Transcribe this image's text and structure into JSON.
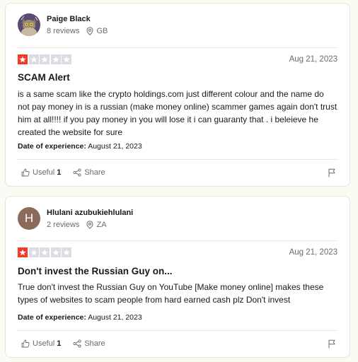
{
  "reviews": [
    {
      "reviewer_name": "Paige Black",
      "reviews_count": "8 reviews",
      "country": "GB",
      "avatar_initial": "",
      "rating": 1,
      "date": "Aug 21, 2023",
      "title": "SCAM Alert",
      "body": "is a same scam like the crypto holdings.com just different colour and the name do not pay money in is a russian (make money online) scammer games again don't trust him at all!!!! if you pay money in you will lose it i can guaranty that . i beleieve he created the website for sure",
      "experience_label": "Date of experience:",
      "experience_date": "August 21, 2023",
      "useful_label": "Useful",
      "useful_count": "1",
      "share_label": "Share"
    },
    {
      "reviewer_name": "Hlulani azubukiehlulani",
      "reviews_count": "2 reviews",
      "country": "ZA",
      "avatar_initial": "H",
      "rating": 1,
      "date": "Aug 21, 2023",
      "title": "Don't invest the Russian Guy on...",
      "body": "True don't invest the Russian Guy on YouTube [Make money online] makes these types of websites to scam people from hard earned cash plz Don't invest",
      "experience_label": "Date of experience:",
      "experience_date": "August 21, 2023",
      "useful_label": "Useful",
      "useful_count": "1",
      "share_label": "Share"
    }
  ],
  "colors": {
    "star_active": "#ff3722",
    "star_inactive": "#dcdce6",
    "background": "#fcfbf3",
    "avatar_initial_bg": "#8c6a5a"
  },
  "icons": [
    "location-pin-icon",
    "thumbs-up-icon",
    "share-icon",
    "flag-icon",
    "star-icon",
    "cat-avatar-image"
  ]
}
